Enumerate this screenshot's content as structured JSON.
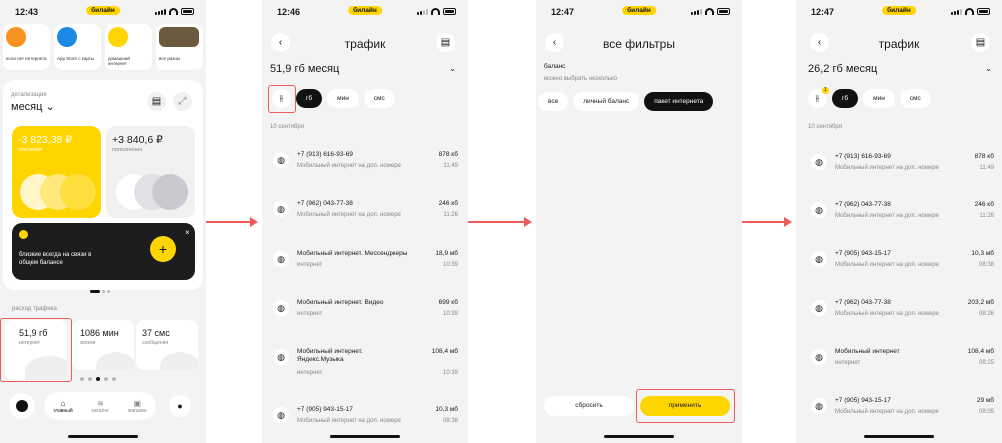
{
  "colors": {
    "accent": "#ffd500",
    "highlight": "#f15a5a",
    "dark": "#111111"
  },
  "status": {
    "carrier": "билайн",
    "p1_time": "12:43",
    "p2_time": "12:46",
    "p3_time": "12:47",
    "p4_time": "12:47"
  },
  "p1": {
    "stories": [
      "если нет интернета",
      "App Store с карты",
      "домашний интернет",
      "все разны"
    ],
    "detail_label": "детализация",
    "period": "месяц",
    "spent_amount": "-3 823,38 ₽",
    "spent_label": "списания",
    "topup_amount": "+3 840,6 ₽",
    "topup_label": "пополнения",
    "promo": "близкие всегда на связи в общем балансе",
    "traffic_label": "расход трафика",
    "traffic": [
      {
        "value": "51,9 гб",
        "label": "интернет"
      },
      {
        "value": "1086 мин",
        "label": "звонки"
      },
      {
        "value": "37 смс",
        "label": "сообщения"
      }
    ],
    "nav": [
      "главный",
      "каталог",
      "магазин"
    ]
  },
  "p2": {
    "title": "трафик",
    "total": "51,9 гб месяц",
    "chips": [
      "гб",
      "мин",
      "смс"
    ],
    "date": "10 сентября",
    "rows": [
      {
        "t1": "+7 (913) 616-93-69",
        "t2": "Мобильный интернет на доп. номере",
        "v": "878 кб",
        "tm": "11:49"
      },
      {
        "t1": "+7 (962) 043-77-38",
        "t2": "Мобильный интернет на доп. номере",
        "v": "246 кб",
        "tm": "11:26"
      },
      {
        "t1": "Мобильный интернет. Мессенджеры",
        "t2": "интернет",
        "v": "18,9 мб",
        "tm": "10:39"
      },
      {
        "t1": "Мобильный интернет. Видео",
        "t2": "интернет",
        "v": "699 кб",
        "tm": "10:39"
      },
      {
        "t1": "Мобильный интернет. Яндекс.Музыка",
        "t2": "интернет",
        "v": "108,4 мб",
        "tm": "10:39"
      },
      {
        "t1": "+7 (905) 943-15-17",
        "t2": "Мобильный интернет на доп. номере",
        "v": "10,3 мб",
        "tm": "08:38"
      }
    ]
  },
  "p3": {
    "title": "все фильтры",
    "section": "баланс",
    "hint": "можно выбрать несколько",
    "chips": [
      "все",
      "личный баланс",
      "пакет интернета"
    ],
    "reset": "сбросить",
    "apply": "применить"
  },
  "p4": {
    "title": "трафик",
    "total": "26,2 гб месяц",
    "badge": "1",
    "chips": [
      "гб",
      "мин",
      "смс"
    ],
    "date": "10 сентября",
    "rows": [
      {
        "t1": "+7 (913) 616-93-69",
        "t2": "Мобильный интернет на доп. номере",
        "v": "878 кб",
        "tm": "11:49"
      },
      {
        "t1": "+7 (962) 043-77-38",
        "t2": "Мобильный интернет на доп. номере",
        "v": "246 кб",
        "tm": "11:26"
      },
      {
        "t1": "+7 (905) 943-15-17",
        "t2": "Мобильный интернет на доп. номере",
        "v": "10,3 мб",
        "tm": "08:38"
      },
      {
        "t1": "+7 (962) 043-77-38",
        "t2": "Мобильный интернет на доп. номере",
        "v": "203,2 мб",
        "tm": "08:26"
      },
      {
        "t1": "Мобильный интернет",
        "t2": "интернет",
        "v": "108,4 мб",
        "tm": "08:25"
      },
      {
        "t1": "+7 (905) 943-15-17",
        "t2": "Мобильный интернет на доп. номере",
        "v": "29 мб",
        "tm": "08:05"
      }
    ]
  }
}
